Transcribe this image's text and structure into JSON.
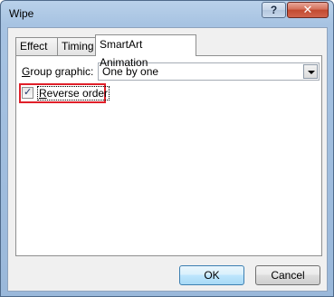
{
  "window": {
    "title": "Wipe",
    "help_label": "?",
    "close_label": "✕"
  },
  "tabs": [
    {
      "label": "Effect",
      "active": false
    },
    {
      "label": "Timing",
      "active": false
    },
    {
      "label": "SmartArt Animation",
      "active": true
    }
  ],
  "panel": {
    "group_graphic_label_underlined": "G",
    "group_graphic_label_rest": "roup graphic:",
    "group_graphic_value": "One by one",
    "reverse_order_underlined": "R",
    "reverse_order_rest": "everse order",
    "reverse_order_checked": true
  },
  "buttons": {
    "ok_label": "OK",
    "cancel_label": "Cancel"
  },
  "colors": {
    "highlight": "#e0202a"
  }
}
